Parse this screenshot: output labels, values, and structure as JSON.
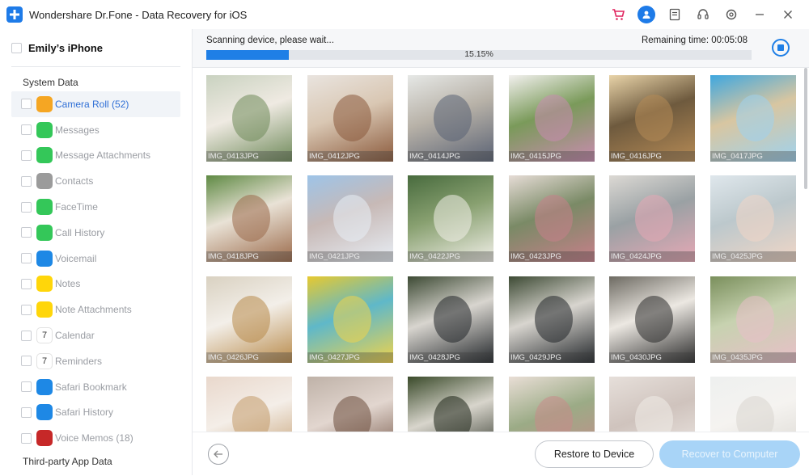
{
  "window": {
    "title": "Wondershare Dr.Fone - Data Recovery for iOS"
  },
  "titlebar_icons": [
    "cart-icon",
    "user-icon",
    "feedback-icon",
    "support-headset-icon",
    "settings-icon",
    "minimize-icon",
    "close-icon"
  ],
  "sidebar": {
    "device_name": "Emily’s iPhone",
    "section_system": "System Data",
    "items": [
      {
        "label": "Camera Roll (52)",
        "icon": "camera-roll-icon",
        "color": "#f5a623",
        "active": true
      },
      {
        "label": "Messages",
        "icon": "messages-icon",
        "color": "#34c759"
      },
      {
        "label": "Message Attachments",
        "icon": "message-attachments-icon",
        "color": "#34c759"
      },
      {
        "label": "Contacts",
        "icon": "contacts-icon",
        "color": "#9b9b9b"
      },
      {
        "label": "FaceTime",
        "icon": "facetime-icon",
        "color": "#34c759"
      },
      {
        "label": "Call History",
        "icon": "call-history-icon",
        "color": "#34c759"
      },
      {
        "label": "Voicemail",
        "icon": "voicemail-icon",
        "color": "#1e88e5"
      },
      {
        "label": "Notes",
        "icon": "notes-icon",
        "color": "#ffd60a"
      },
      {
        "label": "Note Attachments",
        "icon": "note-attachments-icon",
        "color": "#ffd60a"
      },
      {
        "label": "Calendar",
        "icon": "calendar-icon",
        "color": "#ffffff"
      },
      {
        "label": "Reminders",
        "icon": "reminders-icon",
        "color": "#ffffff"
      },
      {
        "label": "Safari Bookmark",
        "icon": "safari-bookmark-icon",
        "color": "#1e88e5"
      },
      {
        "label": "Safari History",
        "icon": "safari-history-icon",
        "color": "#1e88e5"
      },
      {
        "label": "Voice Memos (18)",
        "icon": "voice-memos-icon",
        "color": "#c62828"
      }
    ],
    "section_third_party": "Third-party App Data"
  },
  "scan": {
    "status": "Scanning device, please wait...",
    "remaining": "Remaining time: 00:05:08",
    "progress_label": "15.15%",
    "progress": 0.1515
  },
  "photos": [
    {
      "name": "IMG_0413JPG",
      "colors": [
        "#c9d2c0",
        "#6f8a5a",
        "#efeae2"
      ]
    },
    {
      "name": "IMG_0412JPG",
      "colors": [
        "#e9e4df",
        "#8b5a3c",
        "#d9c7b3"
      ]
    },
    {
      "name": "IMG_0414JPG",
      "colors": [
        "#e6e8e6",
        "#5a6274",
        "#b8b2a8"
      ]
    },
    {
      "name": "IMG_0415JPG",
      "colors": [
        "#f2f0ee",
        "#c98bb0",
        "#7a9a5a"
      ]
    },
    {
      "name": "IMG_0416JPG",
      "colors": [
        "#e8d3a8",
        "#b58a55",
        "#6e5a3e"
      ]
    },
    {
      "name": "IMG_0417JPG",
      "colors": [
        "#3fa7df",
        "#9fd2ee",
        "#d8c6a1"
      ]
    },
    {
      "name": "IMG_0418JPG",
      "colors": [
        "#5f8a44",
        "#9b6a4a",
        "#e9e2d6"
      ]
    },
    {
      "name": "IMG_0421JPG",
      "colors": [
        "#9ec4e8",
        "#e8eef5",
        "#c7b9b6"
      ]
    },
    {
      "name": "IMG_0422JPG",
      "colors": [
        "#486b3e",
        "#f1efe8",
        "#88a070"
      ]
    },
    {
      "name": "IMG_0423JPG",
      "colors": [
        "#e6dcd6",
        "#c77f8a",
        "#7a8a66"
      ]
    },
    {
      "name": "IMG_0424JPG",
      "colors": [
        "#dcd9d4",
        "#e6a8b5",
        "#9aa1a4"
      ]
    },
    {
      "name": "IMG_0425JPG",
      "colors": [
        "#dfe7ec",
        "#f0d6c6",
        "#bcc8cc"
      ]
    },
    {
      "name": "IMG_0426JPG",
      "colors": [
        "#d9d1c1",
        "#b88a4a",
        "#f3efe9"
      ]
    },
    {
      "name": "IMG_0427JPG",
      "colors": [
        "#e7c930",
        "#f0d34a",
        "#5fb8c9"
      ]
    },
    {
      "name": "IMG_0428JPG",
      "colors": [
        "#3d4a34",
        "#22262a",
        "#d8d5cf"
      ]
    },
    {
      "name": "IMG_0429JPG",
      "colors": [
        "#3d4a34",
        "#22262a",
        "#d8d5cf"
      ]
    },
    {
      "name": "IMG_0430JPG",
      "colors": [
        "#6d6a62",
        "#2b2b2b",
        "#ece8e2"
      ]
    },
    {
      "name": "IMG_0435JPG",
      "colors": [
        "#7a8f5c",
        "#e8bfc8",
        "#c7d2b0"
      ]
    },
    {
      "name": "",
      "colors": [
        "#e9d8cc",
        "#c29a6a",
        "#f4eee8"
      ]
    },
    {
      "name": "",
      "colors": [
        "#bfb2a8",
        "#6c4c3c",
        "#e2d6cf"
      ]
    },
    {
      "name": "",
      "colors": [
        "#3a4a2a",
        "#1e2418",
        "#d8d5cc"
      ]
    },
    {
      "name": "",
      "colors": [
        "#e9ded6",
        "#c98a8a",
        "#9bab86"
      ]
    },
    {
      "name": "",
      "colors": [
        "#e6dfda",
        "#f1ece8",
        "#cfc3bd"
      ]
    },
    {
      "name": "",
      "colors": [
        "#eef0ef",
        "#d9d6d0",
        "#f5f3f0"
      ]
    }
  ],
  "bottom": {
    "restore_label": "Restore to Device",
    "recover_label": "Recover to Computer"
  }
}
